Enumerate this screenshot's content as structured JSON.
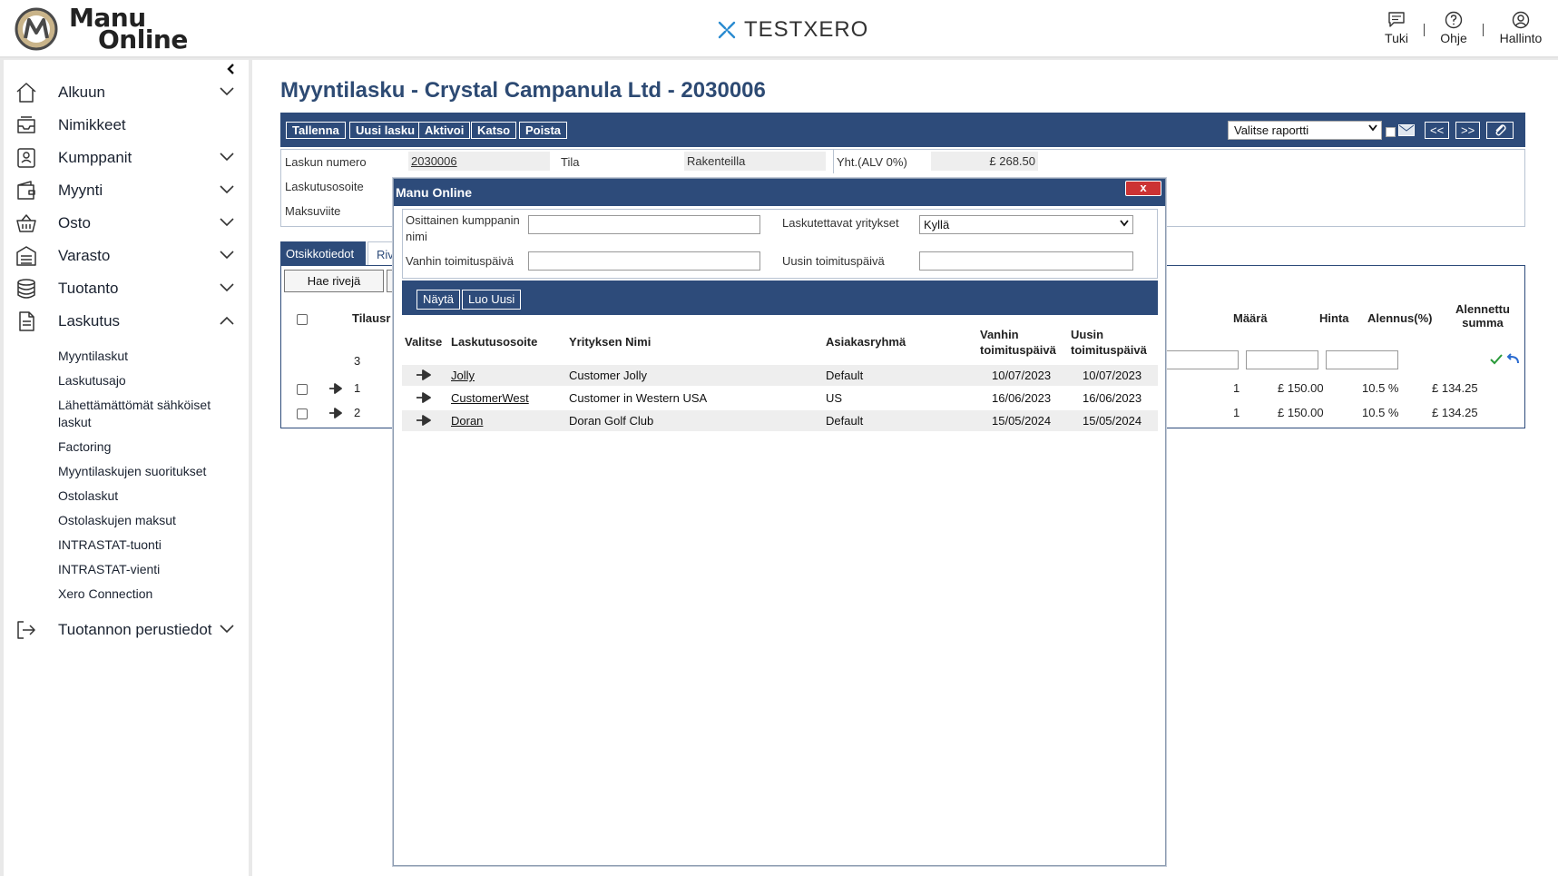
{
  "app": {
    "logo_line1": "Manu",
    "logo_line2": "Online",
    "company": "TESTXERO"
  },
  "top_actions": [
    {
      "label": "Tuki"
    },
    {
      "label": "Ohje"
    },
    {
      "label": "Hallinto"
    }
  ],
  "sidebar": {
    "items": [
      {
        "label": "Alkuun"
      },
      {
        "label": "Nimikkeet"
      },
      {
        "label": "Kumppanit"
      },
      {
        "label": "Myynti"
      },
      {
        "label": "Osto"
      },
      {
        "label": "Varasto"
      },
      {
        "label": "Tuotanto"
      },
      {
        "label": "Laskutus"
      },
      {
        "label": "Tuotannon perustiedot"
      }
    ],
    "sub_items": [
      {
        "label": "Myyntilaskut"
      },
      {
        "label": "Laskutusajo"
      },
      {
        "label": "Lähettämättömät sähköiset"
      },
      {
        "label": "laskut"
      },
      {
        "label": "Factoring"
      },
      {
        "label": "Myyntilaskujen suoritukset"
      },
      {
        "label": "Ostolaskut"
      },
      {
        "label": "Ostolaskujen maksut"
      },
      {
        "label": "INTRASTAT-tuonti"
      },
      {
        "label": "INTRASTAT-vienti"
      },
      {
        "label": "Xero Connection"
      }
    ]
  },
  "page": {
    "title": "Myyntilasku - Crystal Campanula Ltd - 2030006",
    "toolbar": {
      "save": "Tallenna",
      "new": "Uusi lasku",
      "activate": "Aktivoi",
      "view": "Katso",
      "delete": "Poista",
      "report_select": "Valitse raportti",
      "prev": "<<",
      "next": ">>"
    },
    "info": {
      "invoice_number_label": "Laskun numero",
      "invoice_number": "2030006",
      "status_label": "Tila",
      "status": "Rakenteilla",
      "total_label": "Yht.(ALV 0%)",
      "total": "£ 268.50",
      "billing_address_label": "Laskutusosoite",
      "payment_ref_label": "Maksuviite"
    },
    "tabs": {
      "header_tab": "Otsikkotiedot",
      "rows_tab": "Riv"
    },
    "lines": {
      "fetch_button": "Hae rivejä",
      "order_header": "Tilausr",
      "qty_header": "Määrä",
      "price_header": "Hinta",
      "discount_header": "Alennus(%)",
      "discounted_header_1": "Alennettu",
      "discounted_header_2": "summa",
      "new_row_number": "3",
      "rows": [
        {
          "num": "1",
          "qty": "1",
          "price": "£ 150.00",
          "discount": "10.5 %",
          "sum": "£ 134.25"
        },
        {
          "num": "2",
          "qty": "1",
          "price": "£ 150.00",
          "discount": "10.5 %",
          "sum": "£ 134.25"
        }
      ]
    }
  },
  "dialog": {
    "title": "Manu Online",
    "close": "x",
    "filters": {
      "partial_name_label_1": "Osittainen kumppanin",
      "partial_name_label_2": "nimi",
      "billable_label": "Laskutettavat yritykset",
      "billable_value": "Kyllä",
      "old_date_label": "Vanhin toimituspäivä",
      "new_date_label": "Uusin toimituspäivä"
    },
    "buttons": {
      "show": "Näytä",
      "create": "Luo Uusi"
    },
    "headers": {
      "select": "Valitse",
      "billing_address": "Laskutusosoite",
      "company_name": "Yrityksen Nimi",
      "customer_group": "Asiakasryhmä",
      "oldest_1": "Vanhin",
      "oldest_2": "toimituspäivä",
      "newest_1": "Uusin",
      "newest_2": "toimituspäivä"
    },
    "rows": [
      {
        "address": "Jolly",
        "company": "Customer Jolly",
        "group": "Default",
        "oldest": "10/07/2023",
        "newest": "10/07/2023"
      },
      {
        "address": "CustomerWest",
        "company": "Customer in Western USA",
        "group": "US",
        "oldest": "16/06/2023",
        "newest": "16/06/2023"
      },
      {
        "address": "Doran",
        "company": "Doran Golf Club",
        "group": "Default",
        "oldest": "15/05/2024",
        "newest": "15/05/2024"
      }
    ]
  }
}
